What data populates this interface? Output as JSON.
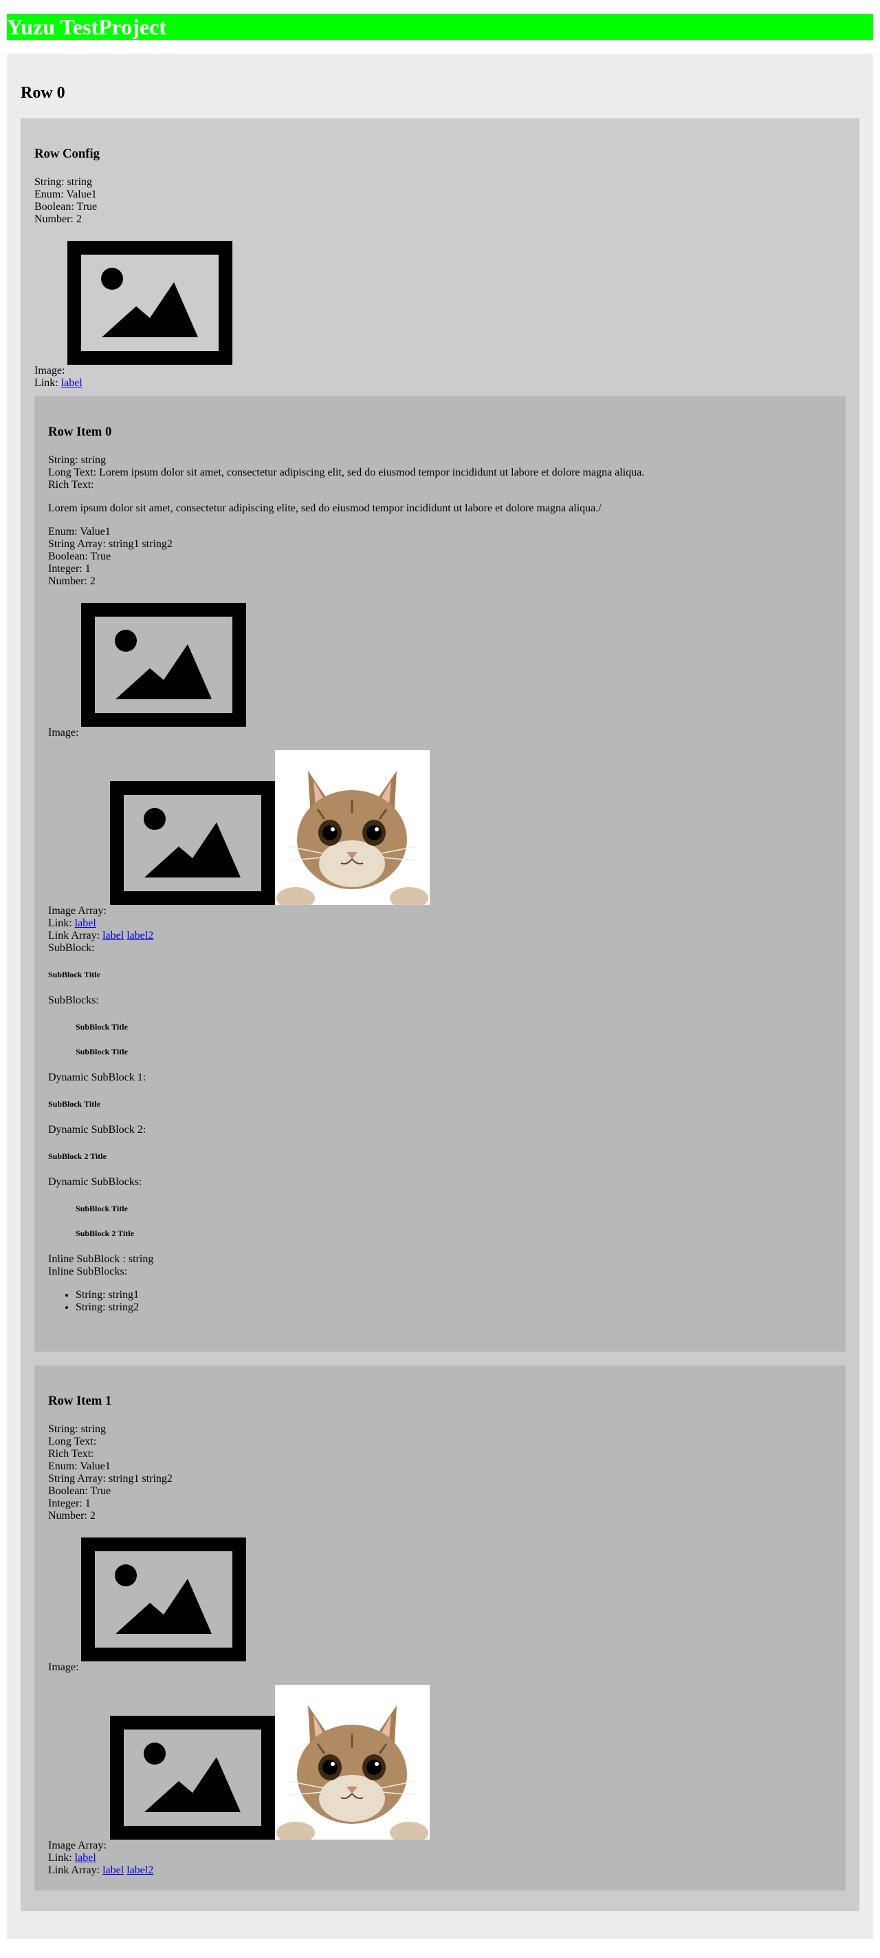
{
  "app": {
    "title": "Yuzu TestProject"
  },
  "row0": {
    "title": "Row 0",
    "config": {
      "title": "Row Config",
      "string_line": "String: string",
      "enum_line": "Enum: Value1",
      "boolean_line": "Boolean: True",
      "number_line": "Number: 2",
      "image_label": "Image:",
      "link_prefix": "Link: ",
      "link_label": "label"
    },
    "items": [
      {
        "title": "Row Item 0",
        "string_line": "String: string",
        "long_text_line": "Long Text: Lorem ipsum dolor sit amet, consectetur adipiscing elit, sed do eiusmod tempor incididunt ut labore et dolore magna aliqua.",
        "rich_text_label": "Rich Text:",
        "rich_text_value": "Lorem ipsum dolor sit amet, consectetur adipiscing elite, sed do eiusmod tempor incididunt ut labore et dolore magna aliqua./",
        "enum_line": "Enum: Value1",
        "string_array_line": "String Array: string1 string2",
        "boolean_line": "Boolean: True",
        "integer_line": "Integer: 1",
        "number_line": "Number: 2",
        "image_label": "Image:",
        "image_array_label": "Image Array:",
        "link_prefix": "Link: ",
        "link_label": "label",
        "link_array_prefix": "Link Array: ",
        "link_array": [
          "label",
          "label2"
        ],
        "subblock_label": "SubBlock:",
        "subblock_title": "SubBlock Title",
        "subblocks_label": "SubBlocks:",
        "subblocks": [
          "SubBlock Title",
          "SubBlock Title"
        ],
        "dynamic_1_label": "Dynamic SubBlock 1:",
        "dynamic_1_title": "SubBlock Title",
        "dynamic_2_label": "Dynamic SubBlock 2:",
        "dynamic_2_title": "SubBlock 2 Title",
        "dynamic_list_label": "Dynamic SubBlocks:",
        "dynamic_list": [
          "SubBlock Title",
          "SubBlock 2 Title"
        ],
        "inline_subblock_line": "Inline SubBlock : string",
        "inline_subblocks_label": "Inline SubBlocks:",
        "inline_subblocks": [
          "String: string1",
          "String: string2"
        ]
      },
      {
        "title": "Row Item 1",
        "string_line": "String: string",
        "long_text_line": "Long Text:",
        "rich_text_label": "Rich Text:",
        "enum_line": "Enum: Value1",
        "string_array_line": "String Array: string1 string2",
        "boolean_line": "Boolean: True",
        "integer_line": "Integer: 1",
        "number_line": "Number: 2",
        "image_label": "Image:",
        "image_array_label": "Image Array:",
        "link_prefix": "Link: ",
        "link_label": "label",
        "link_array_prefix": "Link Array: ",
        "link_array": [
          "label",
          "label2"
        ]
      }
    ]
  },
  "colors": {
    "header_bg": "#00ff00",
    "header_text": "#ffffff",
    "row_bg": "#ececec",
    "config_bg": "#cccccc",
    "item_bg": "#b8b8b8",
    "link": "#0000ee"
  },
  "icons": [
    "image-placeholder-icon",
    "cat-photo"
  ]
}
